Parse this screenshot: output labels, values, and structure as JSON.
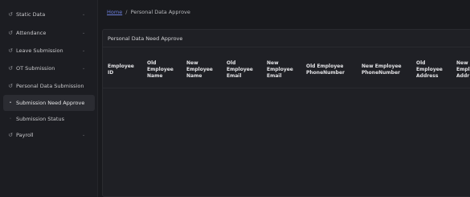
{
  "sidebar": {
    "items": [
      {
        "icon": "↺",
        "label": "Static Data",
        "chevron": "⌄"
      },
      {
        "icon": "↺",
        "label": "Attendance",
        "chevron": "⌄"
      },
      {
        "icon": "↺",
        "label": "Leave Submission",
        "chevron": "⌄"
      },
      {
        "icon": "↺",
        "label": "OT Submission",
        "chevron": "⌄"
      },
      {
        "icon": "↺",
        "label": "Personal Data Submission",
        "chevron": ""
      },
      {
        "icon": "•",
        "label": "Submission Need Approve",
        "chevron": ""
      },
      {
        "icon": "◦",
        "label": "Submission Status",
        "chevron": ""
      },
      {
        "icon": "↺",
        "label": "Payroll",
        "chevron": "⌄"
      }
    ]
  },
  "breadcrumb": {
    "home": "Home",
    "separator": "/",
    "current": "Personal Data Approve"
  },
  "card": {
    "title": "Personal Data Need Approve"
  },
  "table": {
    "headers": [
      [
        "Employee",
        "ID"
      ],
      [
        "Old",
        "Employee",
        "Name"
      ],
      [
        "New",
        "Employee",
        "Name"
      ],
      [
        "Old",
        "Employee",
        "Email"
      ],
      [
        "New",
        "Employee",
        "Email"
      ],
      [
        "Old Employee",
        "PhoneNumber"
      ],
      [
        "New Employee",
        "PhoneNumber"
      ],
      [
        "Old",
        "Employee",
        "Address"
      ],
      [
        "New",
        "Empl",
        "Addr"
      ]
    ]
  },
  "colors": {
    "background": "#191a1e",
    "sidebar": "#1c1d22",
    "active_item": "#2b2c32",
    "link": "#6a7dd8"
  }
}
